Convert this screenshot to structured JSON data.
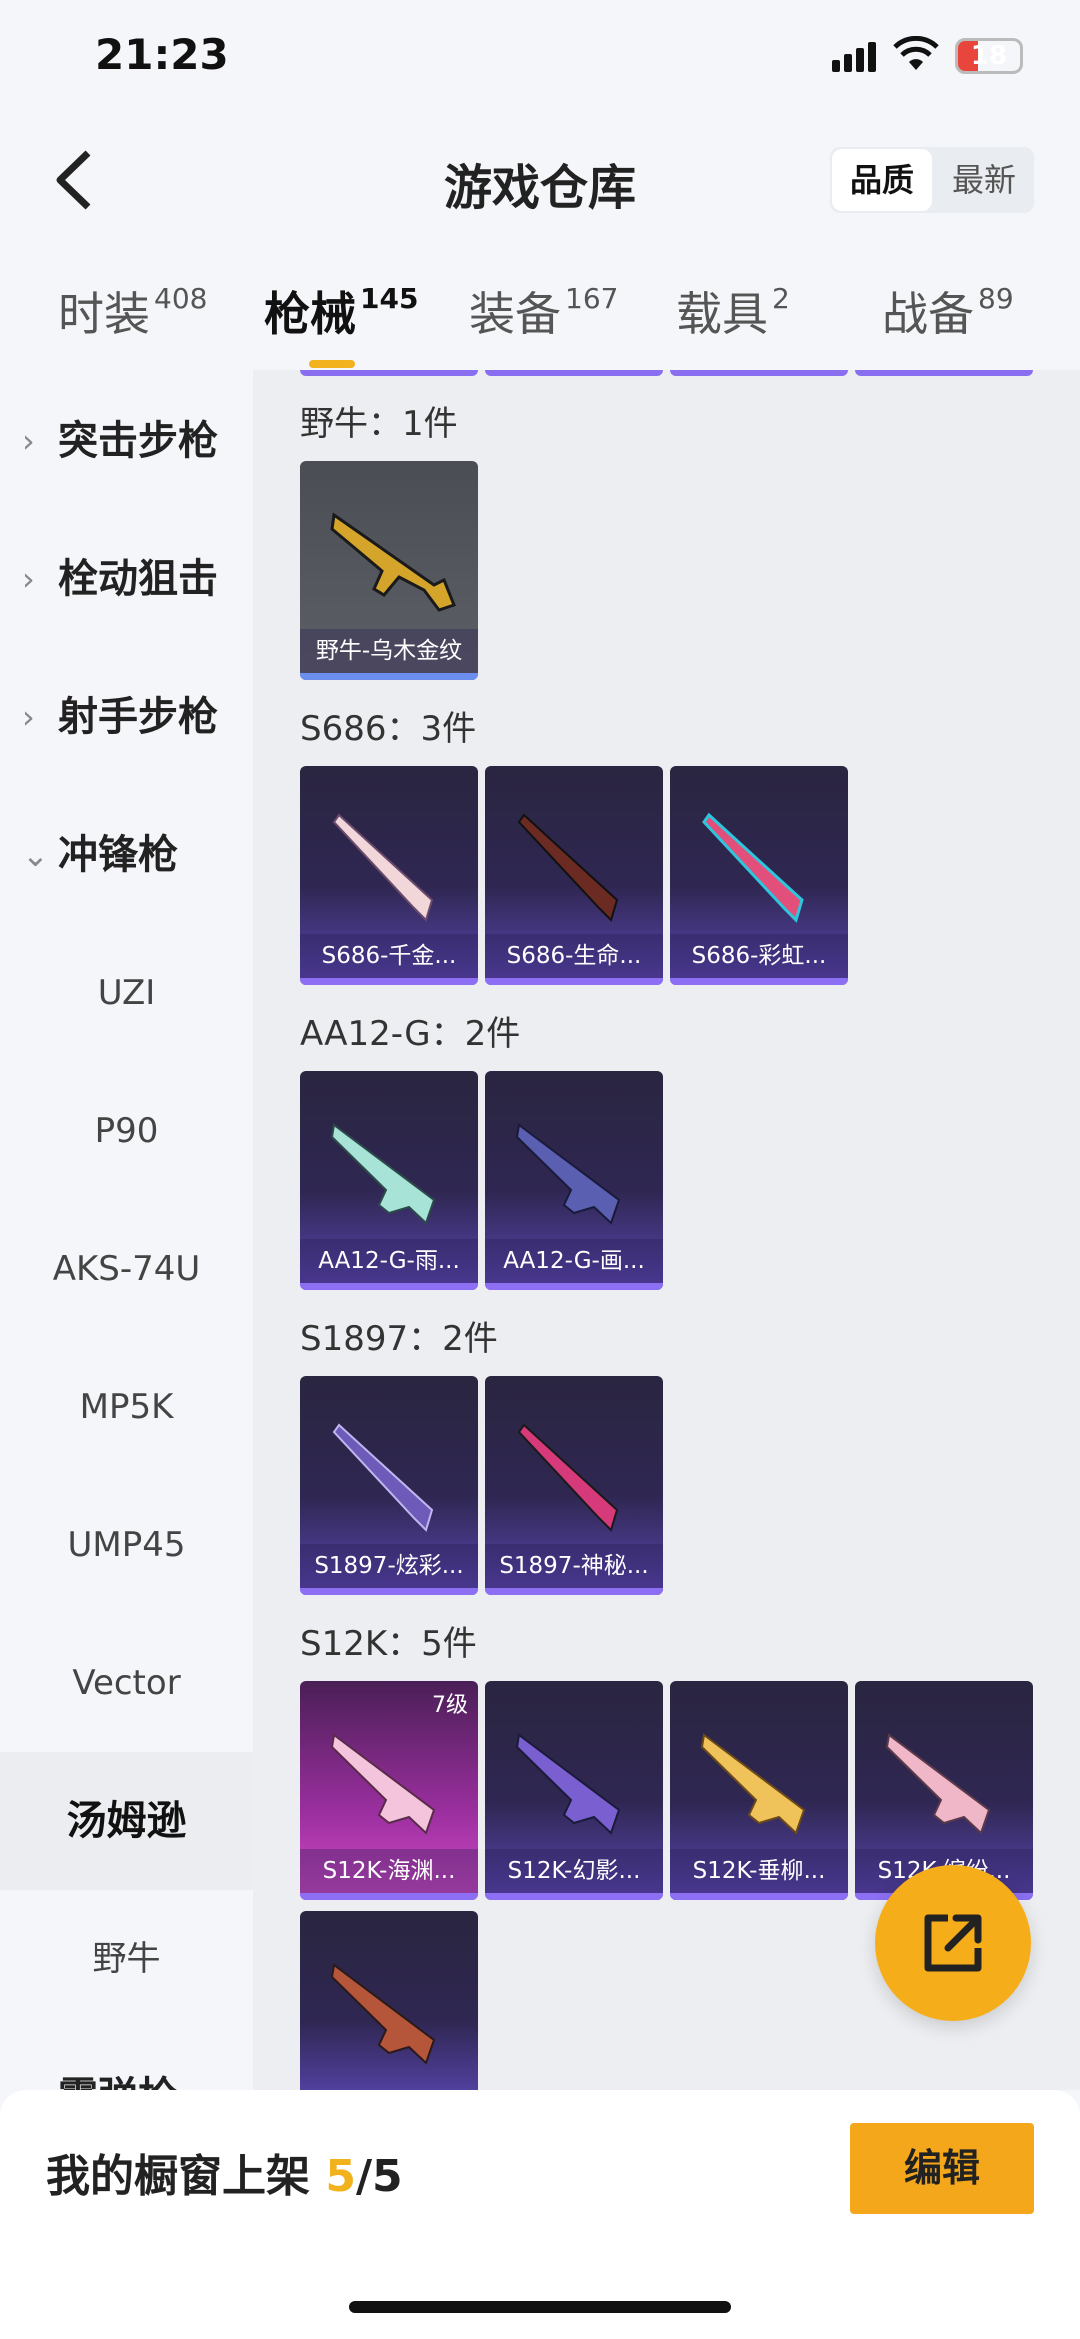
{
  "status": {
    "time": "21:23",
    "battery": "18"
  },
  "header": {
    "title": "游戏仓库",
    "sort_quality": "品质",
    "sort_newest": "最新"
  },
  "tabs": [
    {
      "label": "时装",
      "count": "408"
    },
    {
      "label": "枪械",
      "count": "145"
    },
    {
      "label": "装备",
      "count": "167"
    },
    {
      "label": "载具",
      "count": "2"
    },
    {
      "label": "战备",
      "count": "89"
    }
  ],
  "sidebar": {
    "cat1": "突击步枪",
    "cat2": "栓动狙击",
    "cat3": "射手步枪",
    "cat4": "冲锋枪",
    "sub1": "UZI",
    "sub2": "P90",
    "sub3": "AKS-74U",
    "sub4": "MP5K",
    "sub5": "UMP45",
    "sub6": "Vector",
    "sub7": "汤姆逊",
    "sub8": "野牛",
    "cat5": "霰弹枪"
  },
  "groups": {
    "g1": {
      "label": "野牛：1件",
      "items": [
        "野牛-乌木金纹"
      ]
    },
    "g2": {
      "label": "S686：3件",
      "items": [
        "S686-千金...",
        "S686-生命...",
        "S686-彩虹..."
      ]
    },
    "g3": {
      "label": "AA12-G：2件",
      "items": [
        "AA12-G-雨...",
        "AA12-G-画..."
      ]
    },
    "g4": {
      "label": "S1897：2件",
      "items": [
        "S1897-炫彩...",
        "S1897-神秘..."
      ]
    },
    "g5": {
      "label": "S12K：5件",
      "items": [
        "S12K-海渊...",
        "S12K-幻影...",
        "S12K-垂柳...",
        "S12K-缤纷..."
      ],
      "level": "7级"
    }
  },
  "bottom": {
    "prefix": "我的橱窗上架 ",
    "current": "5",
    "total": "/5",
    "edit": "编辑"
  },
  "colors": {
    "accent": "#f2b21e",
    "card_purple": "#8c6ff2",
    "fab": "#f6ad1a"
  }
}
